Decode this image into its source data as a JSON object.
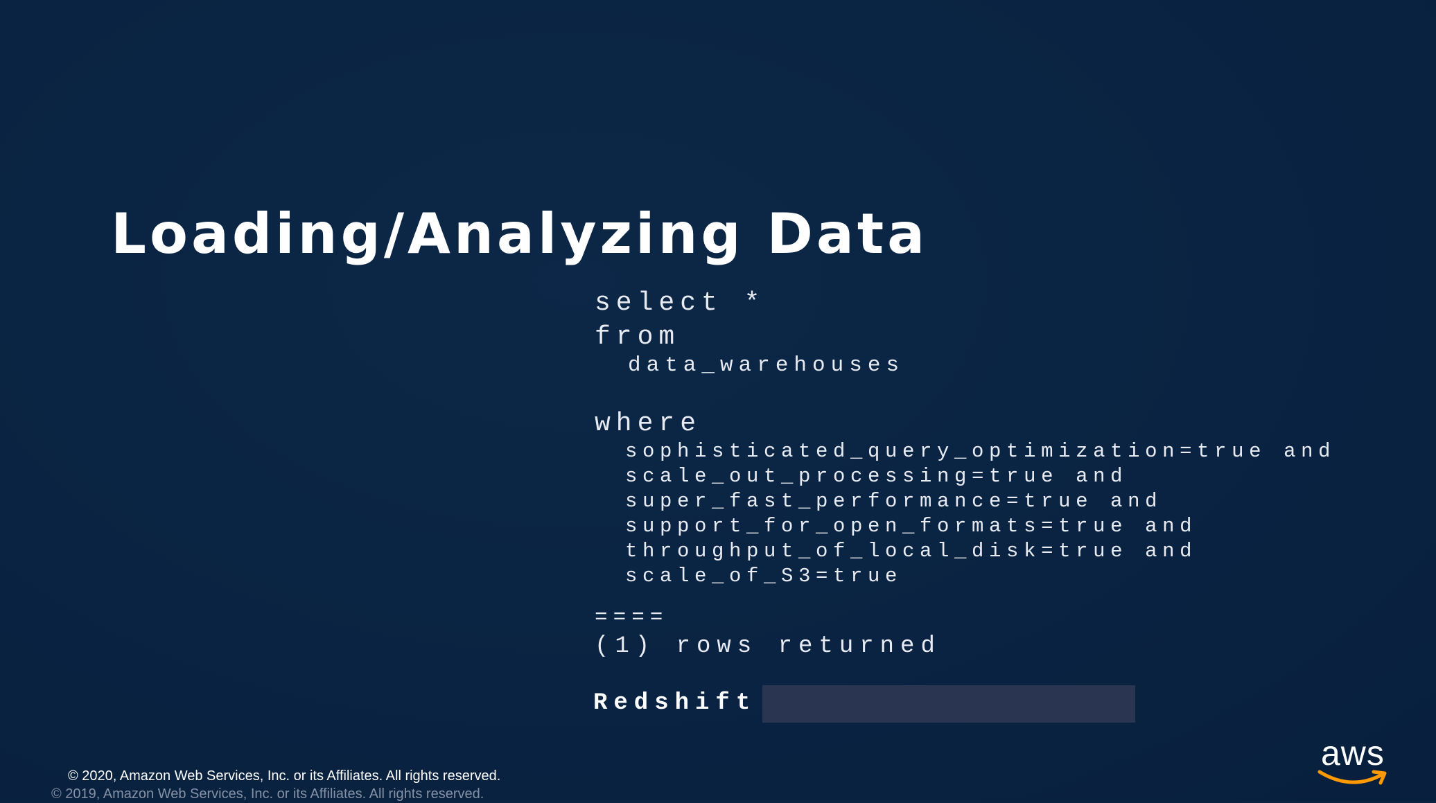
{
  "slide": {
    "title": "Loading/Analyzing Data",
    "query": {
      "select": "select *",
      "from": "from",
      "table": "data_warehouses",
      "where": "where",
      "conditions": [
        "sophisticated_query_optimization=true and",
        "scale_out_processing=true and",
        "super_fast_performance=true and",
        "support_for_open_formats=true and",
        "throughput_of_local_disk=true and",
        "scale_of_S3=true"
      ],
      "separator": "====",
      "result": "(1) rows returned",
      "answer_label": "Redshift"
    },
    "footer": {
      "copyright": "© 2020, Amazon Web Services, Inc. or its Affiliates. All rights reserved.",
      "copyright_old": "© 2019, Amazon Web Services, Inc. or its Affiliates. All rights reserved.",
      "logo_text": "aws",
      "logo_icon": "aws-smile-arrow",
      "logo_accent_color": "#ff9900"
    },
    "colors": {
      "background": "#0a2342",
      "redaction_bar": "#2a3651"
    }
  }
}
